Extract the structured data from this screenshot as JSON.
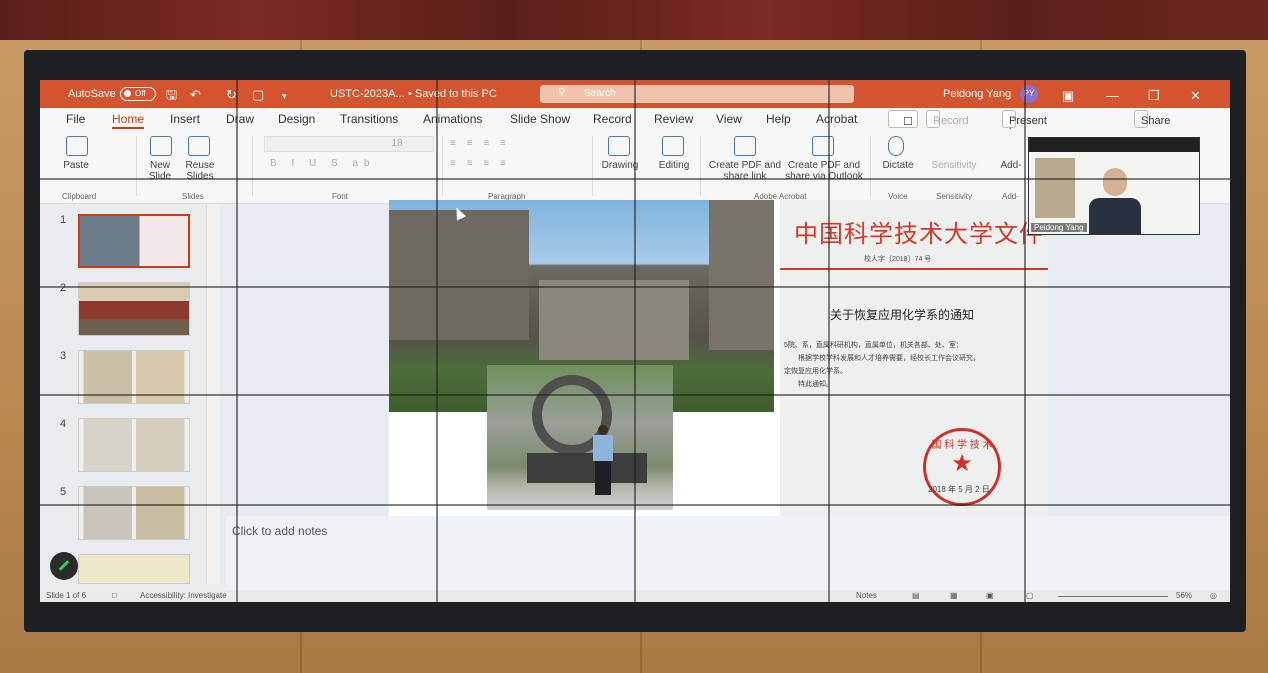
{
  "titlebar": {
    "autosave_label": "AutoSave",
    "autosave_state": "Off",
    "filename": "USTC-2023A...",
    "save_state": "• Saved to this PC",
    "search_placeholder": "Search",
    "user_name": "Peidong Yang",
    "user_initials": "PY"
  },
  "tabs": [
    "File",
    "Home",
    "Insert",
    "Draw",
    "Design",
    "Transitions",
    "Animations",
    "Slide Show",
    "Record",
    "Review",
    "View",
    "Help",
    "Acrobat"
  ],
  "tab_buttons": {
    "record": "Record",
    "present": "Present in Teams",
    "share": "Share"
  },
  "ribbon": {
    "paste": "Paste",
    "new_slide": "New Slide",
    "reuse_slides": "Reuse Slides",
    "font_size": "18",
    "drawing": "Drawing",
    "editing": "Editing",
    "create_pdf": "Create PDF and share link",
    "create_pdf_outlook": "Create PDF and share via Outlook",
    "dictate": "Dictate",
    "sensitivity": "Sensitivity",
    "addins": "Add-",
    "groups": {
      "clipboard": "Clipboard",
      "slides": "Slides",
      "font": "Font",
      "paragraph": "Paragraph",
      "acrobat": "Adobe Acrobat",
      "voice": "Voice",
      "sensitivity": "Sensitivity",
      "addins": "Add-"
    }
  },
  "thumbnails": [
    "1",
    "2",
    "3",
    "4",
    "5"
  ],
  "slide_doc": {
    "heading": "中国科学技术大学文件",
    "doc_number": "校人字〔2018〕74 号",
    "subject": "关于恢复应用化学系的通知",
    "line1": "5院、系，直属科研机构，直属单位，机关各部、处、室：",
    "line2": "根据学校学科发展和人才培养需要，经校长工作会议研究，",
    "line3": "定恢复应用化学系。",
    "line4": "特此通知。",
    "date": "2018 年 5 月 2 日"
  },
  "notes_placeholder": "Click to add notes",
  "status": {
    "slide_count": "Slide 1 of 6",
    "accessibility": "Accessibility: Investigate",
    "notes": "Notes",
    "zoom": "56%"
  },
  "video": {
    "participant": "Peidong Yang"
  },
  "colors": {
    "accent": "#d4542f",
    "seal_red": "#cf2f2a"
  }
}
